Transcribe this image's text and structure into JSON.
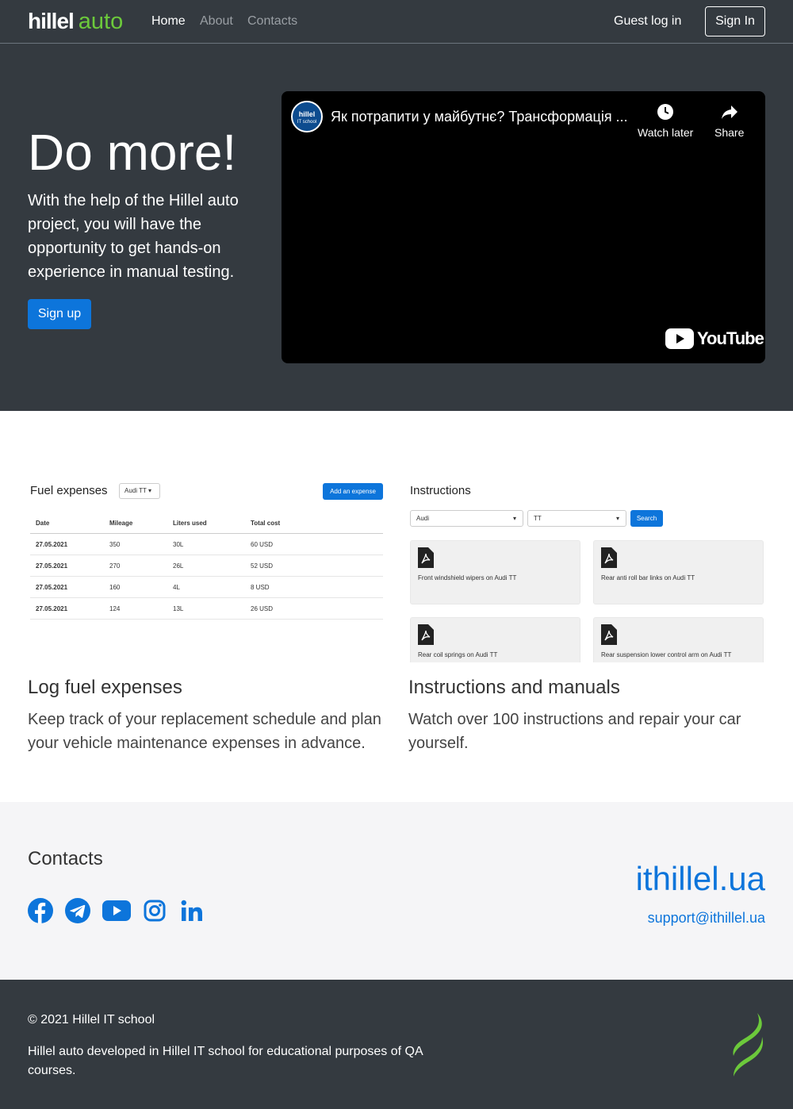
{
  "header": {
    "logo_text": "hillel",
    "logo_accent": "auto",
    "nav": [
      "Home",
      "About",
      "Contacts"
    ],
    "guest_login": "Guest log in",
    "sign_in": "Sign In"
  },
  "hero": {
    "title": "Do more!",
    "text": "With the help of the Hillel auto project, you will have the opportunity to get hands-on experience in manual testing.",
    "signup": "Sign up",
    "video": {
      "channel_badge_1": "hillel",
      "channel_badge_2": "IT school",
      "title": "Як потрапити у майбутнє? Трансформація ...",
      "watch_later": "Watch later",
      "share": "Share",
      "brand": "YouTube"
    }
  },
  "features": {
    "fuel": {
      "title": "Log fuel expenses",
      "desc": "Keep track of your replacement schedule and plan your vehicle maintenance expenses in advance.",
      "mock": {
        "heading": "Fuel expenses",
        "car_select": "Audi TT",
        "add_button": "Add an expense",
        "columns": [
          "Date",
          "Mileage",
          "Liters used",
          "Total cost"
        ],
        "rows": [
          [
            "27.05.2021",
            "350",
            "30L",
            "60 USD"
          ],
          [
            "27.05.2021",
            "270",
            "26L",
            "52 USD"
          ],
          [
            "27.05.2021",
            "160",
            "4L",
            "8 USD"
          ],
          [
            "27.05.2021",
            "124",
            "13L",
            "26 USD"
          ]
        ]
      }
    },
    "instructions": {
      "title": "Instructions and manuals",
      "desc": "Watch over 100 instructions and repair your car yourself.",
      "mock": {
        "heading": "Instructions",
        "brand_select": "Audi",
        "model_select": "TT",
        "search_button": "Search",
        "cards": [
          "Front windshield wipers on Audi TT",
          "Rear anti roll bar links on Audi TT",
          "Rear coil springs on Audi TT",
          "Rear suspension lower control arm on Audi TT"
        ]
      }
    }
  },
  "contacts": {
    "title": "Contacts",
    "social": [
      "facebook-icon",
      "telegram-icon",
      "youtube-icon",
      "instagram-icon",
      "linkedin-icon"
    ],
    "site": "ithillel.ua",
    "email": "support@ithillel.ua"
  },
  "footer": {
    "copyright": "© 2021 Hillel IT school",
    "developed": "Hillel auto developed in Hillel IT school for educational purposes of QA courses."
  },
  "colors": {
    "dark": "#343a40",
    "primary": "#0d75db",
    "green": "#6cc93b",
    "light": "#f5f5f7"
  }
}
